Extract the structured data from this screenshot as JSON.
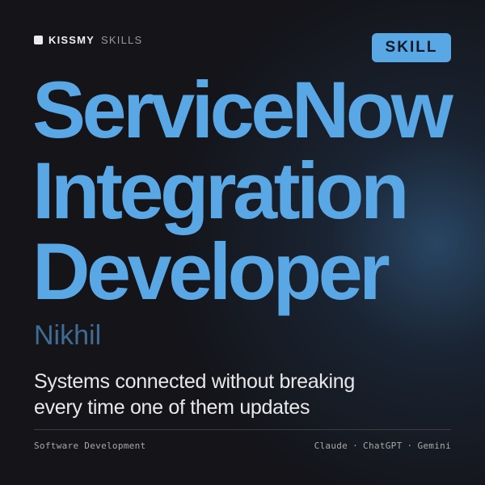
{
  "brand": {
    "name": "KISSMY",
    "sub": "SKILLS"
  },
  "badge": {
    "label": "SKILL"
  },
  "title": {
    "lines": [
      "ServiceNow",
      "Integration",
      "Developer"
    ]
  },
  "author": "Nikhil",
  "tagline": {
    "lines": [
      "Systems connected without breaking",
      "every time one of them updates"
    ]
  },
  "footer": {
    "category": "Software Development",
    "platforms": [
      "Claude",
      "ChatGPT",
      "Gemini"
    ],
    "separator": "·"
  },
  "colors": {
    "accent": "#5aa7e6",
    "author": "#3e6c95",
    "background": "#141419"
  }
}
